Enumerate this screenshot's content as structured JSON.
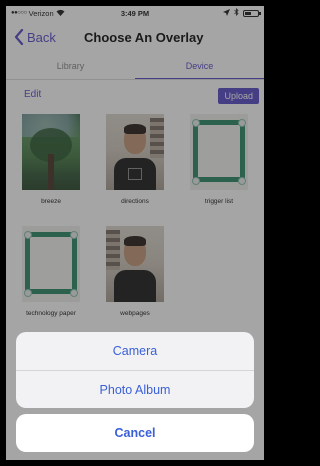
{
  "status_bar": {
    "carrier": "Verizon",
    "time": "3:49 PM"
  },
  "nav": {
    "back_label": "Back",
    "title": "Choose An Overlay"
  },
  "tabs": [
    {
      "label": "Library"
    },
    {
      "label": "Device"
    }
  ],
  "toolbar": {
    "edit_label": "Edit",
    "upload_label": "Upload"
  },
  "overlays": [
    {
      "label": "breeze",
      "thumb": "photo-tree"
    },
    {
      "label": "directions",
      "thumb": "photo-person"
    },
    {
      "label": "trigger list",
      "thumb": "photo-frame"
    },
    {
      "label": "technology paper",
      "thumb": "photo-frame"
    },
    {
      "label": "webpages",
      "thumb": "photo-person"
    }
  ],
  "action_sheet": {
    "options": [
      "Camera",
      "Photo Album"
    ],
    "cancel_label": "Cancel"
  },
  "colors": {
    "accent": "#5b4fc9",
    "action_text": "#3a60d8"
  }
}
